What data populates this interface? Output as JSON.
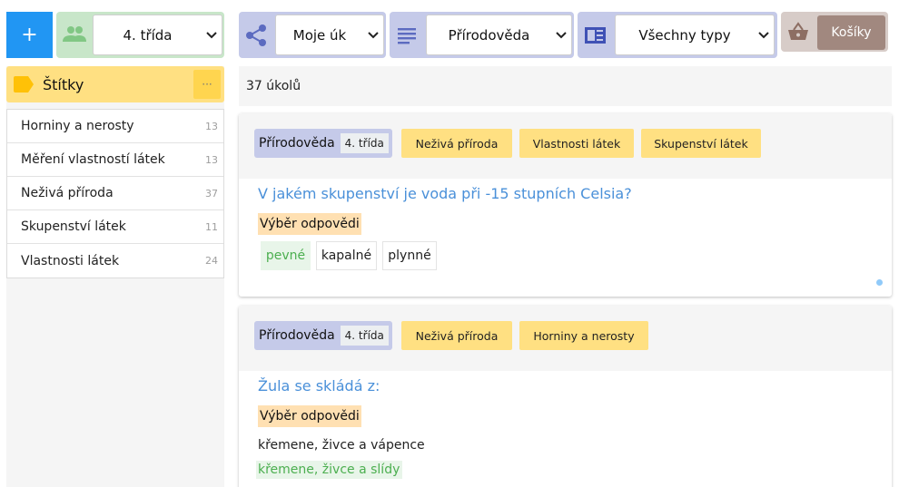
{
  "toolbar": {
    "add_label": "+",
    "class_select": "4. třída",
    "share_select": "Moje úk",
    "subject_select": "Přírodověda",
    "type_select": "Všechny typy",
    "baskets_label": "Košíky"
  },
  "sidebar": {
    "title": "Štítky",
    "menu_label": "···",
    "tags": [
      {
        "label": "Horniny a nerosty",
        "count": "13"
      },
      {
        "label": "Měření vlastností látek",
        "count": "13"
      },
      {
        "label": "Neživá příroda",
        "count": "37"
      },
      {
        "label": "Skupenství látek",
        "count": "11"
      },
      {
        "label": "Vlastnosti látek",
        "count": "24"
      }
    ]
  },
  "main": {
    "count_text": "37 úkolů",
    "cards": [
      {
        "subject": "Přírodověda",
        "grade": "4. třída",
        "tags": [
          "Neživá příroda",
          "Vlastnosti látek",
          "Skupenství látek"
        ],
        "question": "V jakém skupenství je voda při -15 stupních Celsia?",
        "type": "Výběr odpovědi",
        "options": [
          {
            "text": "pevné",
            "correct": true
          },
          {
            "text": "kapalné",
            "correct": false
          },
          {
            "text": "plynné",
            "correct": false
          }
        ]
      },
      {
        "subject": "Přírodověda",
        "grade": "4. třída",
        "tags": [
          "Neživá příroda",
          "Horniny a nerosty"
        ],
        "question": "Žula se skládá z:",
        "type": "Výběr odpovědi",
        "options": [
          {
            "text": "křemene, živce a vápence",
            "correct": false
          },
          {
            "text": "křemene, živce a slídy",
            "correct": true
          }
        ]
      }
    ]
  },
  "colors": {
    "accent_blue": "#2196f3",
    "group_green": "#c8e6c9",
    "group_indigo": "#c5cae9",
    "group_brown": "#d7ccc8",
    "tag_yellow": "#ffe082",
    "question_blue": "#4a90d9",
    "correct_green": "#4caf50",
    "type_orange": "#ffe0b2"
  },
  "icons": {
    "class": "people-icon",
    "share": "share-icon",
    "subject": "list-icon",
    "type": "article-icon",
    "cart": "basket-icon",
    "tags": "label-icon",
    "dropdown": "chevron-down-icon"
  }
}
